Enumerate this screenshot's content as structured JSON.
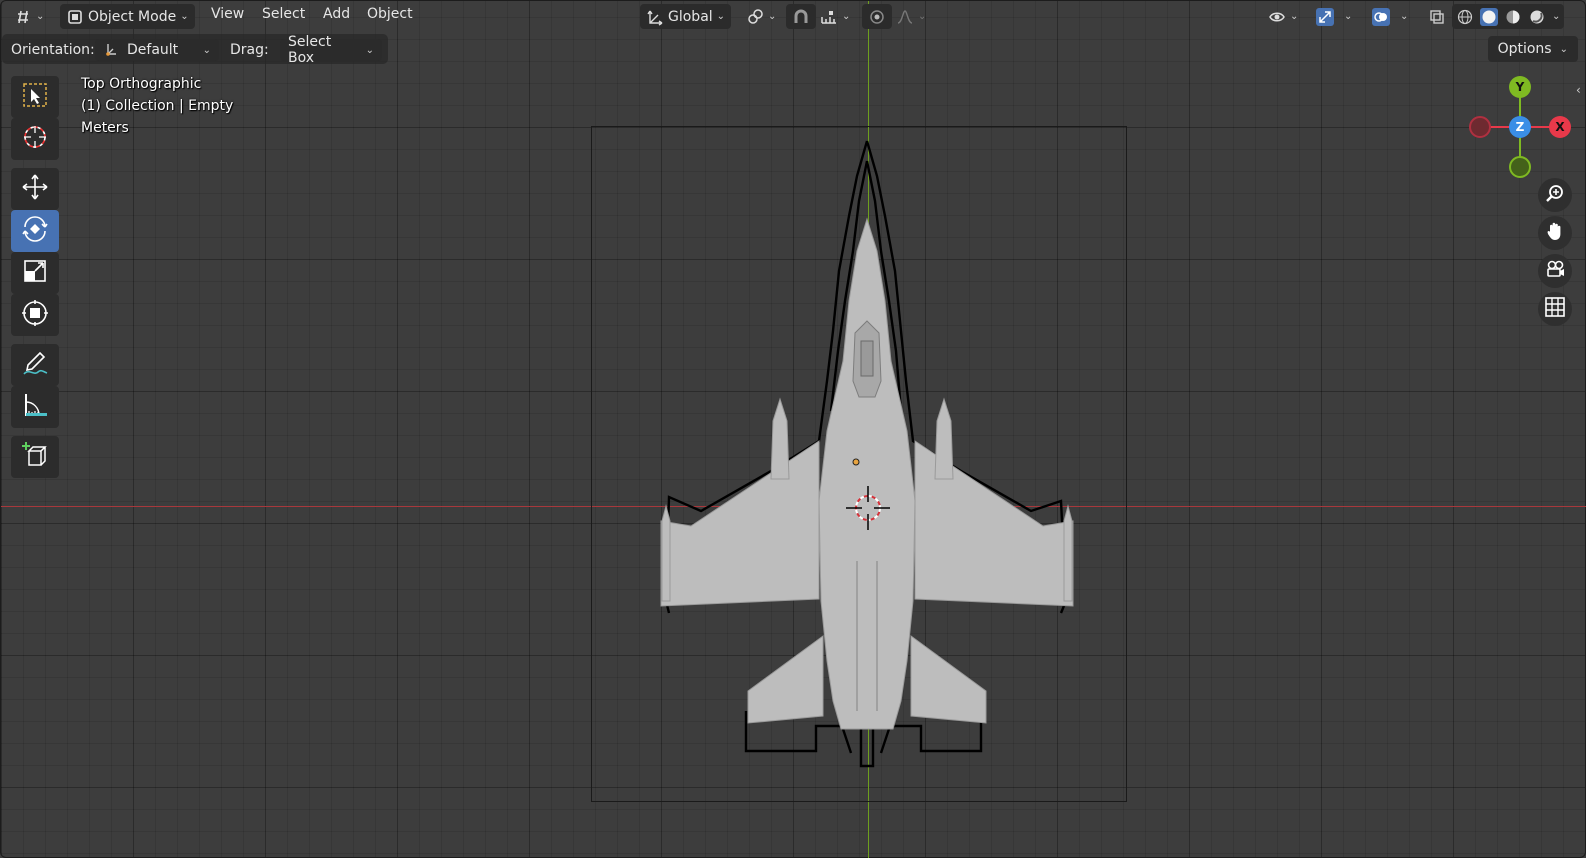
{
  "header": {
    "editor_type_icon": "editor-type-icon",
    "mode": "Object Mode",
    "menus": [
      "View",
      "Select",
      "Add",
      "Object"
    ],
    "transform_orientation": "Global",
    "icons": [
      "transform-pivot-icon",
      "pivot-point-icon",
      "snap-magnet-icon",
      "snap-increment-icon",
      "proportional-edit-icon",
      "falloff-curve-icon",
      "visibility-icon",
      "gizmo-icon",
      "overlay-icon",
      "xray-icon",
      "wireframe-shading-icon",
      "solid-shading-icon",
      "material-shading-icon",
      "rendered-shading-icon"
    ]
  },
  "tool_settings": {
    "orientation_label": "Orientation:",
    "orientation_value": "Default",
    "drag_label": "Drag:",
    "drag_value": "Select Box",
    "options_label": "Options"
  },
  "tools": [
    {
      "name": "select-box-tool",
      "icon": "select-box-icon",
      "active": false
    },
    {
      "name": "cursor-tool",
      "icon": "cursor-icon",
      "active": false
    },
    {
      "name": "move-tool",
      "icon": "move-icon",
      "active": false
    },
    {
      "name": "rotate-tool",
      "icon": "rotate-icon",
      "active": true
    },
    {
      "name": "scale-tool",
      "icon": "scale-icon",
      "active": false
    },
    {
      "name": "transform-tool",
      "icon": "transform-icon",
      "active": false
    },
    {
      "name": "annotate-tool",
      "icon": "annotate-icon",
      "active": false
    },
    {
      "name": "measure-tool",
      "icon": "measure-icon",
      "active": false
    },
    {
      "name": "add-cube-tool",
      "icon": "add-cube-icon",
      "active": false
    }
  ],
  "viewport_info": {
    "view_name": "Top Orthographic",
    "collection": "(1) Collection | Empty",
    "units": "Meters"
  },
  "gizmo": {
    "y_label": "Y",
    "z_label": "Z",
    "x_label": "X",
    "colors": {
      "x": "#e8394a",
      "y": "#7fba22",
      "z": "#3a8ee6"
    }
  },
  "nav_buttons": [
    "zoom-icon",
    "pan-hand-icon",
    "camera-view-icon",
    "ortho-grid-icon"
  ]
}
